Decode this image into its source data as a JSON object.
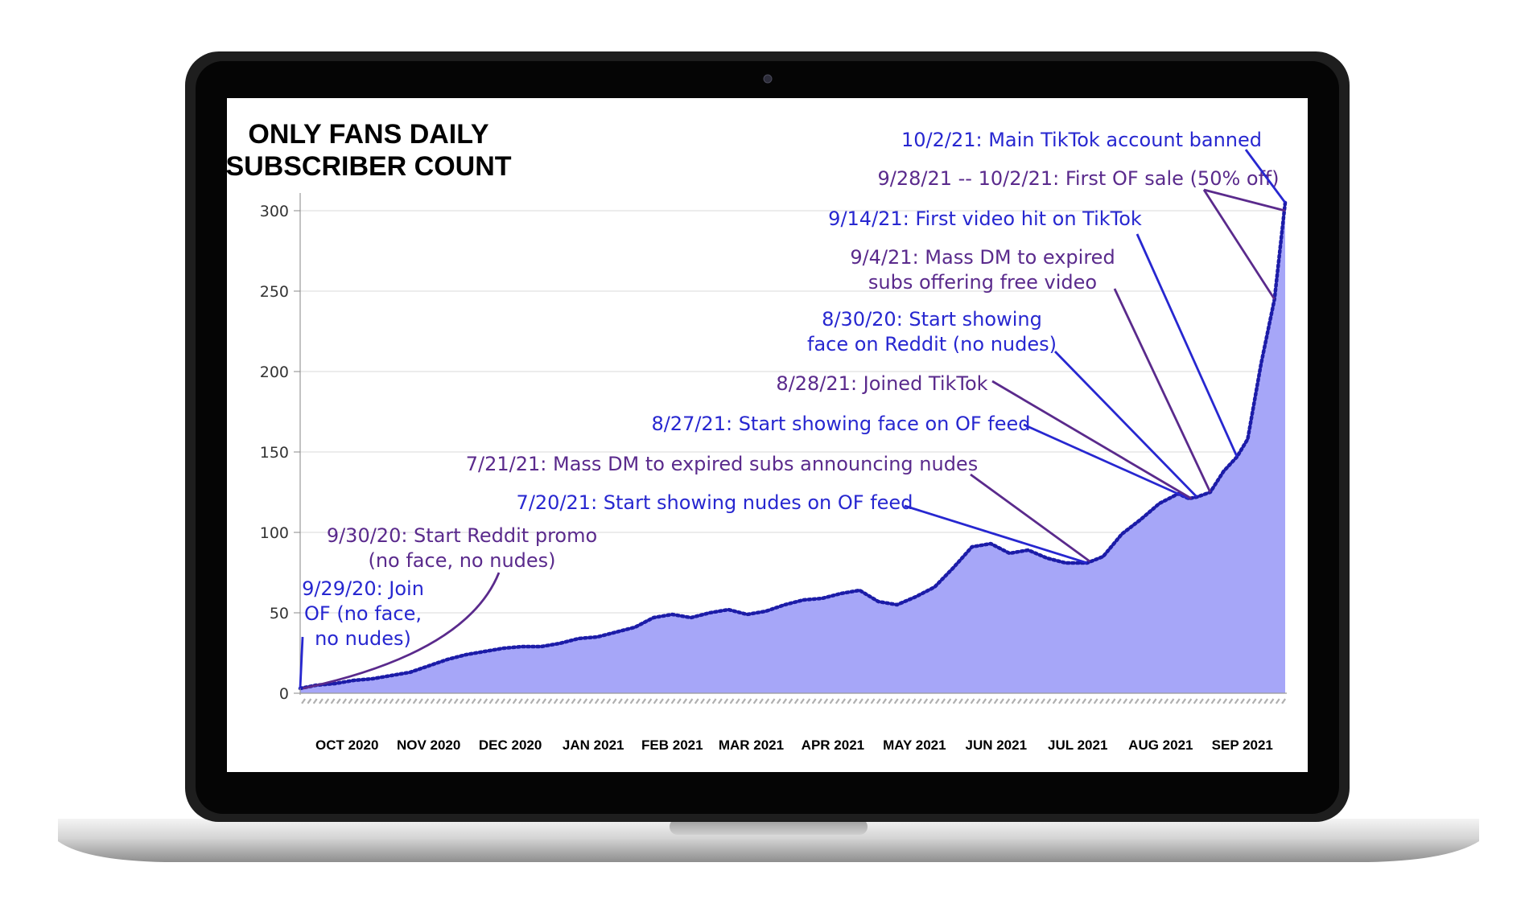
{
  "chart_data": {
    "type": "area",
    "title_lines": [
      "ONLY FANS DAILY",
      "SUBSCRIBER COUNT"
    ],
    "ylim": [
      0,
      300
    ],
    "yticks": [
      0,
      50,
      100,
      150,
      200,
      250,
      300
    ],
    "grid": true,
    "xlim": [
      "2020-09-29",
      "2021-10-02"
    ],
    "month_labels": [
      "OCT 2020",
      "NOV 2020",
      "DEC 2020",
      "JAN 2021",
      "FEB 2021",
      "MAR 2021",
      "APR 2021",
      "MAY 2021",
      "JUN 2021",
      "JUL 2021",
      "AUG 2021",
      "SEP 2021"
    ],
    "colors": {
      "fill": "#a6a6f8",
      "line": "#1c1ca8",
      "ann_blue": "#2727d0",
      "ann_purple": "#5a2a8c"
    },
    "series": [
      {
        "x": [
          "2020-09-29",
          "2020-10-05",
          "2020-10-12",
          "2020-10-19",
          "2020-10-26",
          "2020-11-02",
          "2020-11-09",
          "2020-11-16",
          "2020-11-23",
          "2020-11-30",
          "2020-12-07",
          "2020-12-14",
          "2020-12-21",
          "2020-12-28",
          "2021-01-04",
          "2021-01-11",
          "2021-01-18",
          "2021-01-25",
          "2021-02-01",
          "2021-02-08",
          "2021-02-15",
          "2021-02-22",
          "2021-03-01",
          "2021-03-08",
          "2021-03-15",
          "2021-03-22",
          "2021-03-29",
          "2021-04-05",
          "2021-04-12",
          "2021-04-19",
          "2021-04-26",
          "2021-05-03",
          "2021-05-10",
          "2021-05-17",
          "2021-05-24",
          "2021-05-31",
          "2021-06-07",
          "2021-06-14",
          "2021-06-21",
          "2021-06-28",
          "2021-07-05",
          "2021-07-12",
          "2021-07-20",
          "2021-07-26",
          "2021-08-02",
          "2021-08-09",
          "2021-08-16",
          "2021-08-23",
          "2021-08-27",
          "2021-08-30",
          "2021-09-04",
          "2021-09-09",
          "2021-09-14",
          "2021-09-18",
          "2021-09-23",
          "2021-09-28",
          "2021-10-02"
        ],
        "y": [
          3,
          5,
          6,
          8,
          9,
          11,
          13,
          17,
          21,
          24,
          26,
          28,
          29,
          29,
          31,
          34,
          35,
          38,
          41,
          47,
          49,
          47,
          50,
          52,
          49,
          51,
          55,
          58,
          59,
          62,
          64,
          57,
          55,
          60,
          66,
          78,
          91,
          93,
          87,
          89,
          84,
          81,
          81,
          85,
          99,
          108,
          118,
          124,
          121,
          122,
          125,
          138,
          147,
          158,
          205,
          245,
          305
        ]
      }
    ],
    "annotations": [
      {
        "text": [
          "9/29/20: Join",
          "OF (no face,",
          "no nudes)"
        ],
        "color": "blue",
        "x": "2020-09-29",
        "y": 3
      },
      {
        "text": [
          "9/30/20: Start Reddit promo",
          "(no face, no nudes)"
        ],
        "color": "purple",
        "x": "2020-09-30",
        "y": 3
      },
      {
        "text": [
          "7/20/21: Start showing nudes on OF feed"
        ],
        "color": "blue",
        "x": "2021-07-20",
        "y": 81
      },
      {
        "text": [
          "7/21/21: Mass DM to expired subs announcing nudes"
        ],
        "color": "purple",
        "x": "2021-07-21",
        "y": 82
      },
      {
        "text": [
          "8/27/21: Start showing face on OF feed"
        ],
        "color": "blue",
        "x": "2021-08-27",
        "y": 121
      },
      {
        "text": [
          "8/28/21: Joined TikTok"
        ],
        "color": "purple",
        "x": "2021-08-28",
        "y": 121
      },
      {
        "text": [
          "8/30/20: Start showing",
          "face on Reddit (no nudes)"
        ],
        "color": "blue",
        "x": "2021-08-30",
        "y": 122
      },
      {
        "text": [
          "9/4/21: Mass DM to expired",
          "subs offering free video"
        ],
        "color": "purple",
        "x": "2021-09-04",
        "y": 125
      },
      {
        "text": [
          "9/14/21: First video hit on TikTok"
        ],
        "color": "blue",
        "x": "2021-09-14",
        "y": 147
      },
      {
        "text": [
          "9/28/21 -- 10/2/21: First OF sale (50% off)"
        ],
        "color": "purple",
        "x": "2021-09-28",
        "y": 245,
        "x2": "2021-10-02",
        "y2": 300
      },
      {
        "text": [
          "10/2/21: Main TikTok account banned"
        ],
        "color": "blue",
        "x": "2021-10-02",
        "y": 305
      }
    ]
  }
}
